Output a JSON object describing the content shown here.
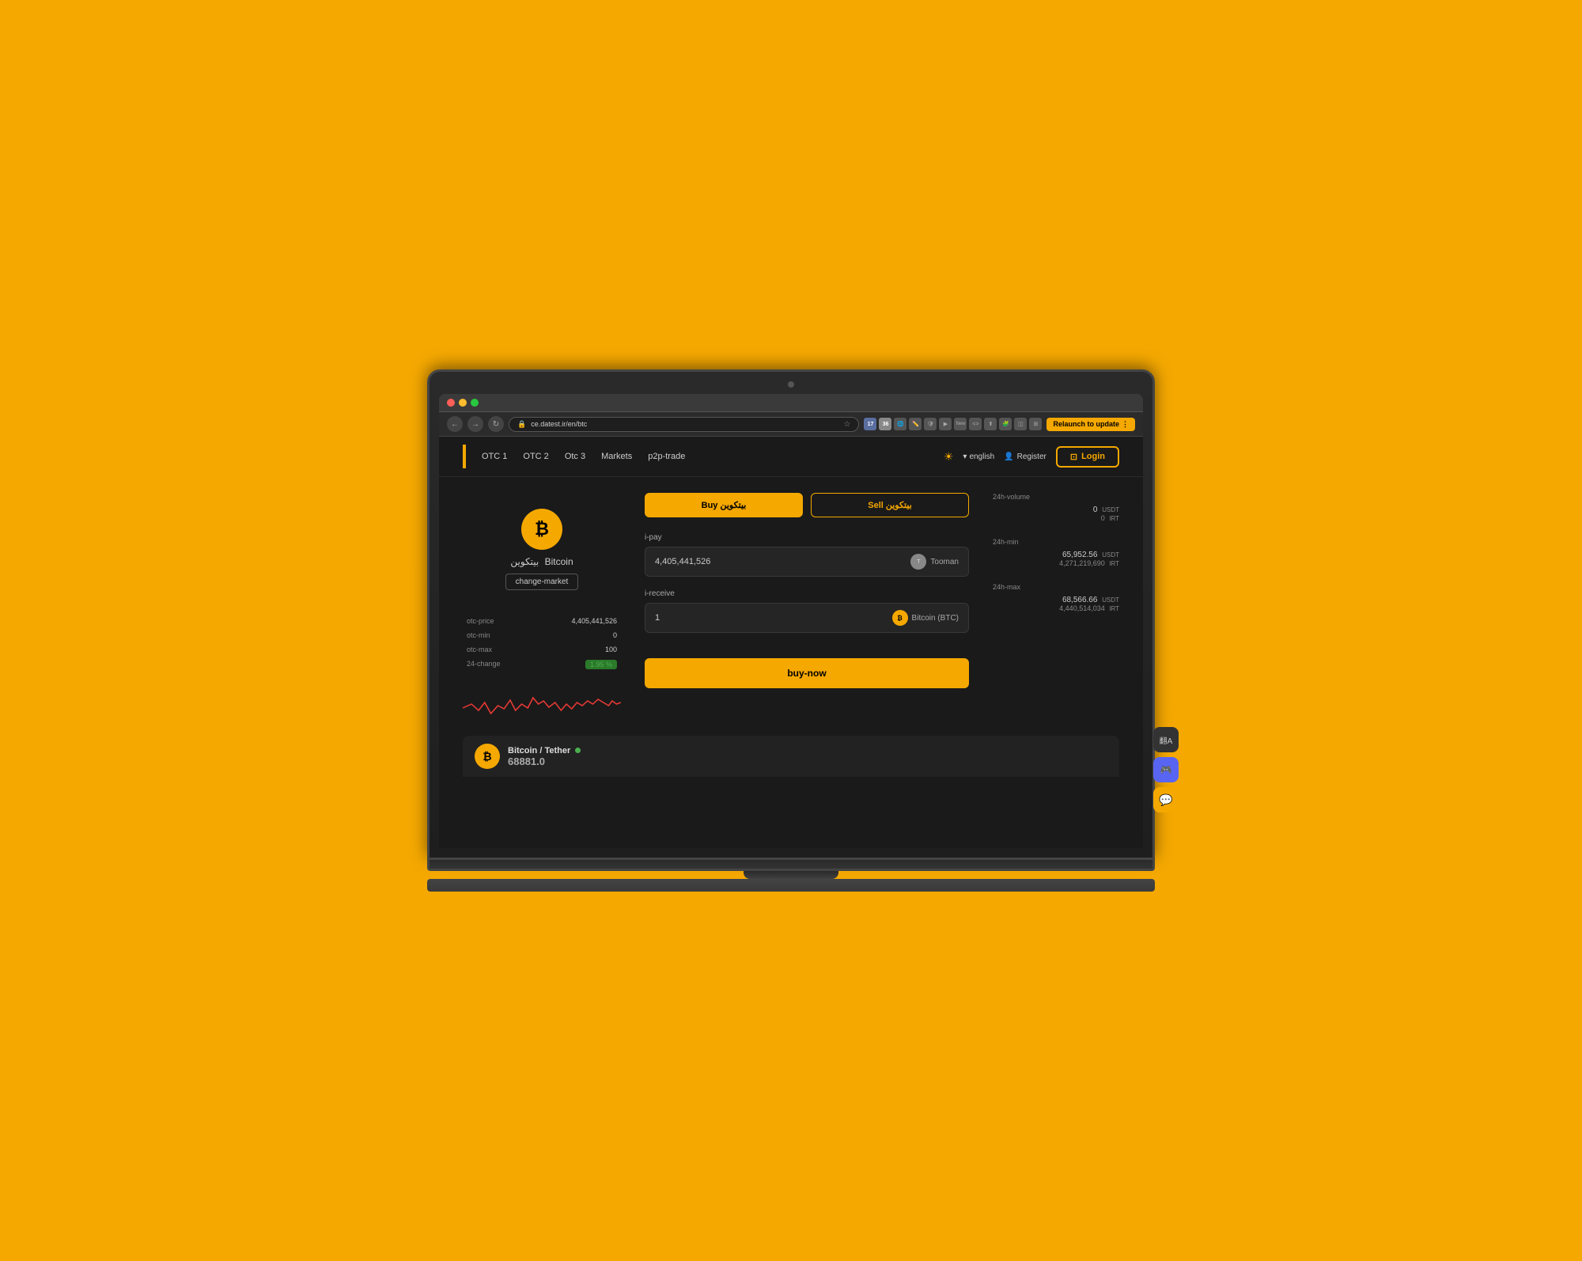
{
  "browser": {
    "url": "ce.datest.ir/en/btc",
    "relaunch_label": "Relaunch to update"
  },
  "nav": {
    "otc1": "OTC 1",
    "otc2": "OTC 2",
    "otc3": "Otc 3",
    "markets": "Markets",
    "p2p": "p2p-trade",
    "lang": "english",
    "register": "Register",
    "login": "Login"
  },
  "coin": {
    "name_en": "Bitcoin",
    "name_fa": "بیتکوین",
    "symbol": "₿",
    "change_market": "change-market"
  },
  "stats": {
    "otc_price_label": "otc-price",
    "otc_price_val": "4,405,441,526",
    "otc_min_label": "otc-min",
    "otc_min_val": "0",
    "otc_max_label": "otc-max",
    "otc_max_val": "100",
    "change_label": "24-change",
    "change_val": "1.95 %"
  },
  "form": {
    "buy_label": "Buy بیتکوین",
    "sell_label": "Sell بیتکوین",
    "i_pay_label": "i-pay",
    "i_pay_val": "4,405,441,526",
    "i_pay_currency": "Tooman",
    "i_receive_label": "i-receive",
    "i_receive_val": "1",
    "i_receive_currency": "Bitcoin (BTC)",
    "buy_now": "buy-now"
  },
  "volume_24h": {
    "label": "24h-volume",
    "usdt_val": "0",
    "usdt_currency": "USDT",
    "irt_val": "0",
    "irt_currency": "IRT"
  },
  "min_24h": {
    "label": "24h-min",
    "usdt_val": "65,952.56",
    "usdt_currency": "USDT",
    "irt_val": "4,271,219,690",
    "irt_currency": "IRT"
  },
  "max_24h": {
    "label": "24h-max",
    "usdt_val": "68,566.66",
    "usdt_currency": "USDT",
    "irt_val": "4,440,514,034",
    "irt_currency": "IRT"
  },
  "ticker": {
    "pair": "Bitcoin / Tether",
    "price": "68881.0",
    "dot_color": "#4caf50"
  },
  "ext_badges": {
    "badge1": "17",
    "badge2": "36"
  }
}
